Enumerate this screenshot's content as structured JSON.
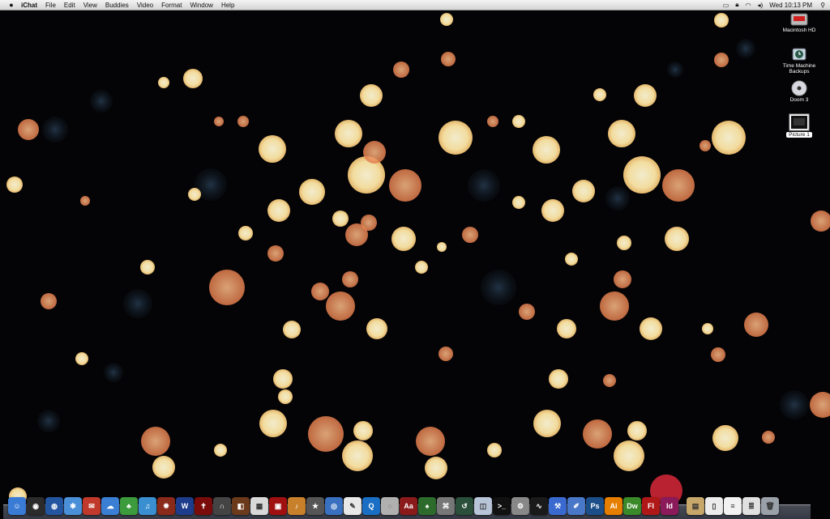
{
  "menubar": {
    "apple_icon": "apple-icon",
    "app_name": "iChat",
    "menus": [
      "File",
      "Edit",
      "View",
      "Buddies",
      "Video",
      "Format",
      "Window",
      "Help"
    ],
    "status_icons": [
      "keyboard-icon",
      "lock-icon",
      "wifi-icon",
      "volume-icon"
    ],
    "clock": "Wed 10:13 PM",
    "spotlight_icon": "spotlight-icon"
  },
  "desktop": {
    "icons": [
      {
        "label": "Macintosh HD",
        "icon": "hard-drive-icon"
      },
      {
        "label": "Time Machine Backups",
        "icon": "time-machine-icon"
      },
      {
        "label": "Doom 3",
        "icon": "disc-icon"
      },
      {
        "label": "Picture 1",
        "icon": "picture-icon"
      }
    ]
  },
  "dock": {
    "apps": [
      {
        "name": "finder-icon",
        "glyph": "☺",
        "color": "#3a7bd5"
      },
      {
        "name": "dashboard-icon",
        "glyph": "◉",
        "color": "#2b2b2b"
      },
      {
        "name": "google-earth-icon",
        "glyph": "◍",
        "color": "#2355a0"
      },
      {
        "name": "safari-icon",
        "glyph": "✱",
        "color": "#4a90d9"
      },
      {
        "name": "mail-icon",
        "glyph": "✉",
        "color": "#c0392b"
      },
      {
        "name": "ichat-icon",
        "glyph": "☁",
        "color": "#3b7fd4"
      },
      {
        "name": "adium-icon",
        "glyph": "♣",
        "color": "#3c9b3c"
      },
      {
        "name": "itunes-icon",
        "glyph": "♫",
        "color": "#3a8fd0"
      },
      {
        "name": "burn-icon",
        "glyph": "✹",
        "color": "#8a2a1a"
      },
      {
        "name": "warcraft-icon",
        "glyph": "W",
        "color": "#1e3c8c"
      },
      {
        "name": "cross-icon",
        "glyph": "✝",
        "color": "#7a0b0b"
      },
      {
        "name": "headphones-icon",
        "glyph": "∩",
        "color": "#444"
      },
      {
        "name": "photo-booth-icon",
        "glyph": "◧",
        "color": "#6b3a1a"
      },
      {
        "name": "iphoto-icon",
        "glyph": "▦",
        "color": "#d8d8d8"
      },
      {
        "name": "photo-app-icon",
        "glyph": "▣",
        "color": "#a01010"
      },
      {
        "name": "garageband-icon",
        "glyph": "♪",
        "color": "#c9802a"
      },
      {
        "name": "imovie-icon",
        "glyph": "★",
        "color": "#555"
      },
      {
        "name": "idvd-icon",
        "glyph": "◎",
        "color": "#3a70c0"
      },
      {
        "name": "textedit-icon",
        "glyph": "✎",
        "color": "#e8e8e8"
      },
      {
        "name": "quicktime-icon",
        "glyph": "Q",
        "color": "#1a6fc4"
      },
      {
        "name": "disc-utility-icon",
        "glyph": "◌",
        "color": "#b0b0b0"
      },
      {
        "name": "dictionary-icon",
        "glyph": "Aa",
        "color": "#8b1a1a"
      },
      {
        "name": "tree-icon",
        "glyph": "♠",
        "color": "#2d6b2d"
      },
      {
        "name": "script-icon",
        "glyph": "⌘",
        "color": "#777"
      },
      {
        "name": "time-machine-dock-icon",
        "glyph": "↺",
        "color": "#2a4f3a"
      },
      {
        "name": "preview-icon",
        "glyph": "◫",
        "color": "#b8c4d8"
      },
      {
        "name": "terminal-icon",
        "glyph": ">_",
        "color": "#111"
      },
      {
        "name": "system-prefs-icon",
        "glyph": "⚙",
        "color": "#888"
      },
      {
        "name": "activity-monitor-icon",
        "glyph": "∿",
        "color": "#1a1a1a"
      },
      {
        "name": "xcode-icon",
        "glyph": "⚒",
        "color": "#3a6ad0"
      },
      {
        "name": "interface-builder-icon",
        "glyph": "✐",
        "color": "#4a78c8"
      },
      {
        "name": "photoshop-icon",
        "glyph": "Ps",
        "color": "#1c4f8a"
      },
      {
        "name": "illustrator-icon",
        "glyph": "Ai",
        "color": "#e67e00"
      },
      {
        "name": "dreamweaver-icon",
        "glyph": "Dw",
        "color": "#3b8a2a"
      },
      {
        "name": "flash-icon",
        "glyph": "Fl",
        "color": "#b01818"
      },
      {
        "name": "indesign-icon",
        "glyph": "Id",
        "color": "#8a1a5a"
      }
    ],
    "docs": [
      {
        "name": "folder-stack-icon",
        "glyph": "▤",
        "color": "#c8a86a"
      },
      {
        "name": "document-icon",
        "glyph": "▯",
        "color": "#ececec"
      },
      {
        "name": "text-document-icon",
        "glyph": "≡",
        "color": "#f2f2f2"
      },
      {
        "name": "pages-document-icon",
        "glyph": "≣",
        "color": "#e0e0e0"
      },
      {
        "name": "trash-icon",
        "glyph": "🗑",
        "color": "#9aa0a8"
      }
    ]
  }
}
